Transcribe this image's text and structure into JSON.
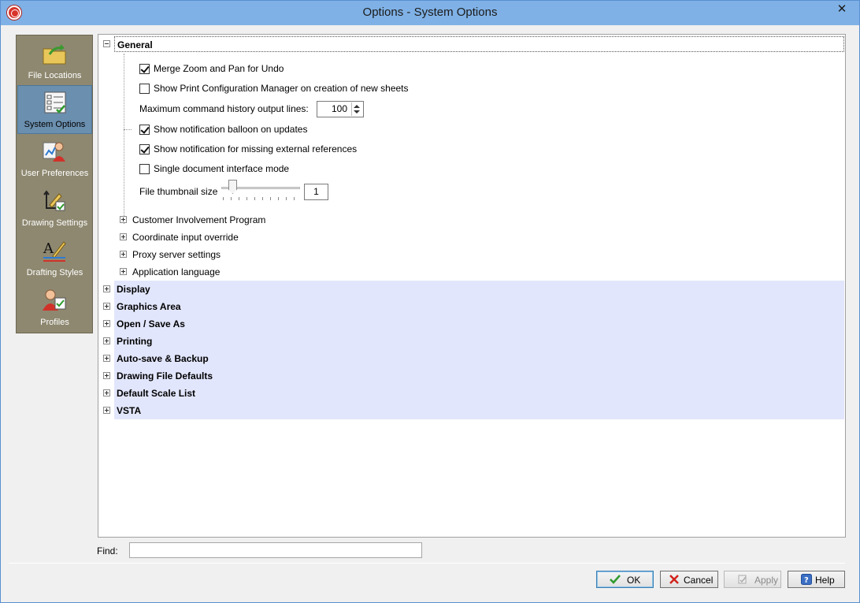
{
  "window": {
    "title": "Options - System Options",
    "close_symbol": "✕"
  },
  "sidebar": {
    "items": [
      {
        "label": "File Locations",
        "icon": "folder-arrow-icon",
        "active": false
      },
      {
        "label": "System Options",
        "icon": "checklist-icon",
        "active": true
      },
      {
        "label": "User Preferences",
        "icon": "user-preferences-icon",
        "active": false
      },
      {
        "label": "Drawing Settings",
        "icon": "drawing-settings-icon",
        "active": false
      },
      {
        "label": "Drafting Styles",
        "icon": "drafting-styles-icon",
        "active": false
      },
      {
        "label": "Profiles",
        "icon": "profiles-icon",
        "active": false
      }
    ]
  },
  "tree": {
    "general": {
      "label": "General",
      "options": {
        "merge_zoom": {
          "label": "Merge Zoom and Pan for Undo",
          "checked": true
        },
        "show_print_config": {
          "label": "Show Print Configuration Manager on creation of new sheets",
          "checked": false
        },
        "max_history_label": "Maximum command history output lines:",
        "max_history_value": "100",
        "notification_balloon": {
          "label": "Show notification balloon on updates",
          "checked": true
        },
        "missing_refs": {
          "label": "Show notification for missing external references",
          "checked": true
        },
        "single_doc": {
          "label": "Single document interface mode",
          "checked": false
        },
        "thumbnail_label": "File thumbnail size",
        "thumbnail_value": "1",
        "thumbnail_level": 1
      },
      "subsections": [
        "Customer Involvement Program",
        "Coordinate input override",
        "Proxy server settings",
        "Application language"
      ]
    },
    "sections": [
      "Display",
      "Graphics Area",
      "Open / Save As",
      "Printing",
      "Auto-save & Backup",
      "Drawing File Defaults",
      "Default Scale List",
      "VSTA"
    ]
  },
  "find": {
    "label": "Find:",
    "value": ""
  },
  "buttons": {
    "ok": "OK",
    "cancel": "Cancel",
    "apply": "Apply",
    "help": "Help"
  },
  "colors": {
    "section_bg": "#e2e6fc",
    "sidebar_bg": "#8e8870",
    "active_item": "#6b8fae",
    "titlebar": "#7fb1e6"
  }
}
